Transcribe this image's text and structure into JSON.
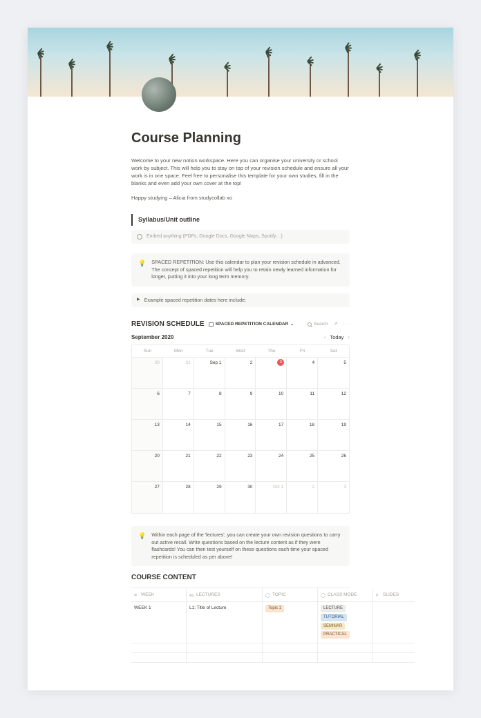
{
  "title": "Course Planning",
  "intro": "Welcome to your new notion workspace. Here you can organise your university or school work by subject. This will help you to stay on top of your revision schedule and ensure all your work is in one space. Feel free to personalise this template for your own studies, fill in the blanks and even add your own cover at the top!",
  "signoff": "Happy studying – Alicia from studycollab xo",
  "syllabus_heading": "Syllabus/Unit outline",
  "embed_placeholder": "Embed anything (PDFs, Google Docs, Google Maps, Spotify…)",
  "callout_spaced": "SPACED REPETITION: Use this calendar to plan your revision schedule in advanced. The concept of spaced repetition will help you to retain newly learned information for longer, putting it into your long term memory.",
  "toggle_spaced": "Example spaced repetition dates here include:",
  "revision": {
    "title": "REVISION SCHEDULE",
    "view_name": "SPACED REPETITION CALENDAR",
    "search_label": "Search",
    "month": "September 2020",
    "today_label": "Today",
    "days": [
      "Sun",
      "Mon",
      "Tue",
      "Wed",
      "Thu",
      "Fri",
      "Sat"
    ],
    "weeks": [
      [
        {
          "n": "30",
          "other": true,
          "shade": true
        },
        {
          "n": "31",
          "other": true
        },
        {
          "n": "Sep 1",
          "label": true
        },
        {
          "n": "2"
        },
        {
          "n": "3",
          "today": true
        },
        {
          "n": "4"
        },
        {
          "n": "5"
        }
      ],
      [
        {
          "n": "6",
          "shade": true
        },
        {
          "n": "7"
        },
        {
          "n": "8"
        },
        {
          "n": "9"
        },
        {
          "n": "10"
        },
        {
          "n": "11"
        },
        {
          "n": "12"
        }
      ],
      [
        {
          "n": "13",
          "shade": true
        },
        {
          "n": "14"
        },
        {
          "n": "15"
        },
        {
          "n": "16"
        },
        {
          "n": "17"
        },
        {
          "n": "18"
        },
        {
          "n": "19"
        }
      ],
      [
        {
          "n": "20",
          "shade": true
        },
        {
          "n": "21"
        },
        {
          "n": "22"
        },
        {
          "n": "23"
        },
        {
          "n": "24"
        },
        {
          "n": "25"
        },
        {
          "n": "26"
        }
      ],
      [
        {
          "n": "27",
          "shade": true
        },
        {
          "n": "28"
        },
        {
          "n": "29"
        },
        {
          "n": "30"
        },
        {
          "n": "Oct 1",
          "other": true,
          "label": true
        },
        {
          "n": "2",
          "other": true
        },
        {
          "n": "3",
          "other": true
        }
      ]
    ]
  },
  "callout_lectures": "Within each page of the 'lectures', you can create your own revision questions to carry out active recall. Write questions based on the lecture content as if they were flashcards! You can then test yourself on these questions each time your spaced repetition is scheduled as per above!",
  "course": {
    "title": "COURSE CONTENT",
    "columns": {
      "week": "WEEK",
      "lectures": "LECTURES",
      "topic": "TOPIC",
      "class_mode": "CLASS MODE",
      "slides": "SLIDES"
    },
    "row1": {
      "week": "WEEK 1",
      "lecture": "L1: Title of Lecture",
      "topic_tag": "Topic 1",
      "modes": [
        "LECTURE",
        "TUTORIAL",
        "SEMINAR",
        "PRACTICAL"
      ]
    }
  }
}
